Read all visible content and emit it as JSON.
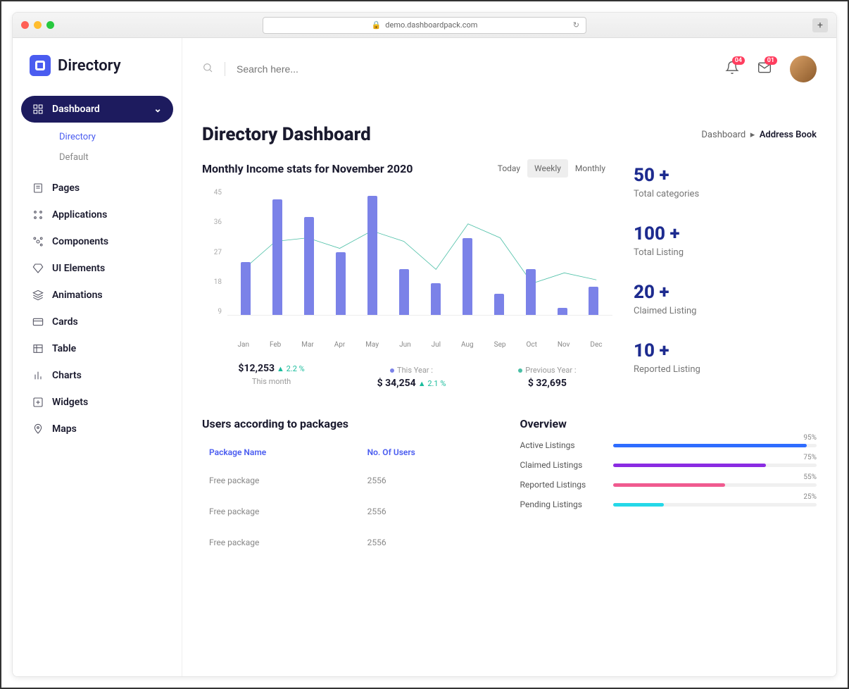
{
  "browser": {
    "url": "demo.dashboardpack.com"
  },
  "brand": "Directory",
  "search": {
    "placeholder": "Search here..."
  },
  "notif_badge": "04",
  "mail_badge": "01",
  "nav": {
    "active": {
      "label": "Dashboard",
      "sub": [
        {
          "label": "Directory",
          "active": true
        },
        {
          "label": "Default",
          "active": false
        }
      ]
    },
    "items": [
      {
        "label": "Pages"
      },
      {
        "label": "Applications"
      },
      {
        "label": "Components"
      },
      {
        "label": "UI Elements"
      },
      {
        "label": "Animations"
      },
      {
        "label": "Cards"
      },
      {
        "label": "Table"
      },
      {
        "label": "Charts"
      },
      {
        "label": "Widgets"
      },
      {
        "label": "Maps"
      }
    ]
  },
  "page": {
    "title": "Directory Dashboard",
    "crumb1": "Dashboard",
    "crumb2": "Address Book"
  },
  "income": {
    "title": "Monthly Income stats for November 2020",
    "seg": {
      "today": "Today",
      "weekly": "Weekly",
      "monthly": "Monthly"
    },
    "stat1": {
      "value": "$12,253",
      "delta": "2.2 %",
      "label": "This month"
    },
    "stat2": {
      "legend": "This Year :",
      "value": "$ 34,254",
      "delta": "2.1 %"
    },
    "stat3": {
      "legend": "Previous Year :",
      "value": "$ 32,695"
    }
  },
  "chart_data": {
    "type": "bar+line",
    "title": "Monthly Income stats for November 2020",
    "categories": [
      "Jan",
      "Feb",
      "Mar",
      "Apr",
      "May",
      "Jun",
      "Jul",
      "Aug",
      "Sep",
      "Oct",
      "Nov",
      "Dec"
    ],
    "series": [
      {
        "name": "This Year",
        "type": "bar",
        "color": "#7b82e8",
        "values": [
          24,
          42,
          37,
          27,
          43,
          22,
          18,
          31,
          15,
          22,
          11,
          17
        ]
      },
      {
        "name": "Previous Year",
        "type": "line",
        "color": "#4bbfa6",
        "values": [
          22,
          30,
          31,
          28,
          33,
          30,
          22,
          35,
          31,
          18,
          21,
          19
        ]
      }
    ],
    "ylabel": "",
    "xlabel": "",
    "ylim": [
      9,
      45
    ],
    "yticks": [
      9,
      18,
      27,
      36,
      45
    ]
  },
  "side_stats": [
    {
      "n": "50 +",
      "t": "Total categories"
    },
    {
      "n": "100 +",
      "t": "Total Listing"
    },
    {
      "n": "20 +",
      "t": "Claimed Listing"
    },
    {
      "n": "10 +",
      "t": "Reported Listing"
    }
  ],
  "packages": {
    "title": "Users according to packages",
    "col1": "Package Name",
    "col2": "No. Of Users",
    "rows": [
      {
        "name": "Free package",
        "users": "2556"
      },
      {
        "name": "Free package",
        "users": "2556"
      },
      {
        "name": "Free package",
        "users": "2556"
      }
    ]
  },
  "overview": {
    "title": "Overview",
    "items": [
      {
        "label": "Active Listings",
        "pct": 95,
        "color": "#2e6cff"
      },
      {
        "label": "Claimed Listings",
        "pct": 75,
        "color": "#8a2be2"
      },
      {
        "label": "Reported Listings",
        "pct": 55,
        "color": "#f05a8f"
      },
      {
        "label": "Pending Listings",
        "pct": 25,
        "color": "#25d8e8"
      }
    ]
  }
}
